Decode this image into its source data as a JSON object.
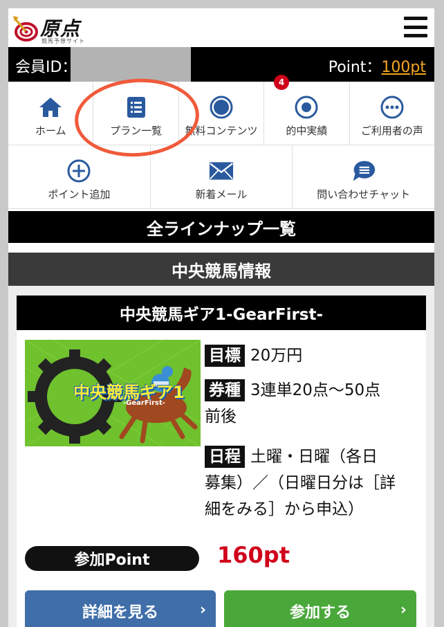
{
  "header": {
    "logo_text": "原点",
    "logo_sub": "競馬予想サイト",
    "menu_icon": "hamburger-icon"
  },
  "member": {
    "id_label": "会員ID：",
    "point_label": "Point：",
    "point_value": "100pt",
    "point_color": "#f5a623"
  },
  "nav": {
    "row1": [
      {
        "label": "ホーム",
        "icon": "home-icon"
      },
      {
        "label": "プラン一覧",
        "icon": "list-icon"
      },
      {
        "label": "無料コンテンツ",
        "icon": "circle-icon"
      },
      {
        "label": "的中実績",
        "icon": "target-icon"
      },
      {
        "label": "ご利用者の声",
        "icon": "chat-dots-icon"
      }
    ],
    "row2": [
      {
        "label": "ポイント追加",
        "icon": "plus-circle-icon"
      },
      {
        "label": "新着メール",
        "icon": "mail-icon",
        "badge": "4"
      },
      {
        "label": "問い合わせチャット",
        "icon": "chat-bubble-icon"
      }
    ],
    "icon_color": "#2a5a9e"
  },
  "lineup": {
    "title": "全ラインナップ一覧"
  },
  "section": {
    "title": "中央競馬情報"
  },
  "plan": {
    "title": "中央競馬ギア1-GearFirst-",
    "image_text": "中央競馬ギア1",
    "image_sub": "-GearFirst-",
    "goal_tag": "目標",
    "goal_value": "20万円",
    "ticket_tag": "券種",
    "ticket_value": "3連単20点〜50点",
    "ticket_value_2": "前後",
    "schedule_tag": "日程",
    "schedule_value_1": "土曜・日曜（各日",
    "schedule_value_2": "募集）／（日曜日分は［詳",
    "schedule_value_3": "細をみる］から申込）",
    "point_label": "参加Point",
    "point_price": "160pt",
    "detail_button": "詳細を見る",
    "join_button": "参加する",
    "accent_red": "#d0021b"
  }
}
